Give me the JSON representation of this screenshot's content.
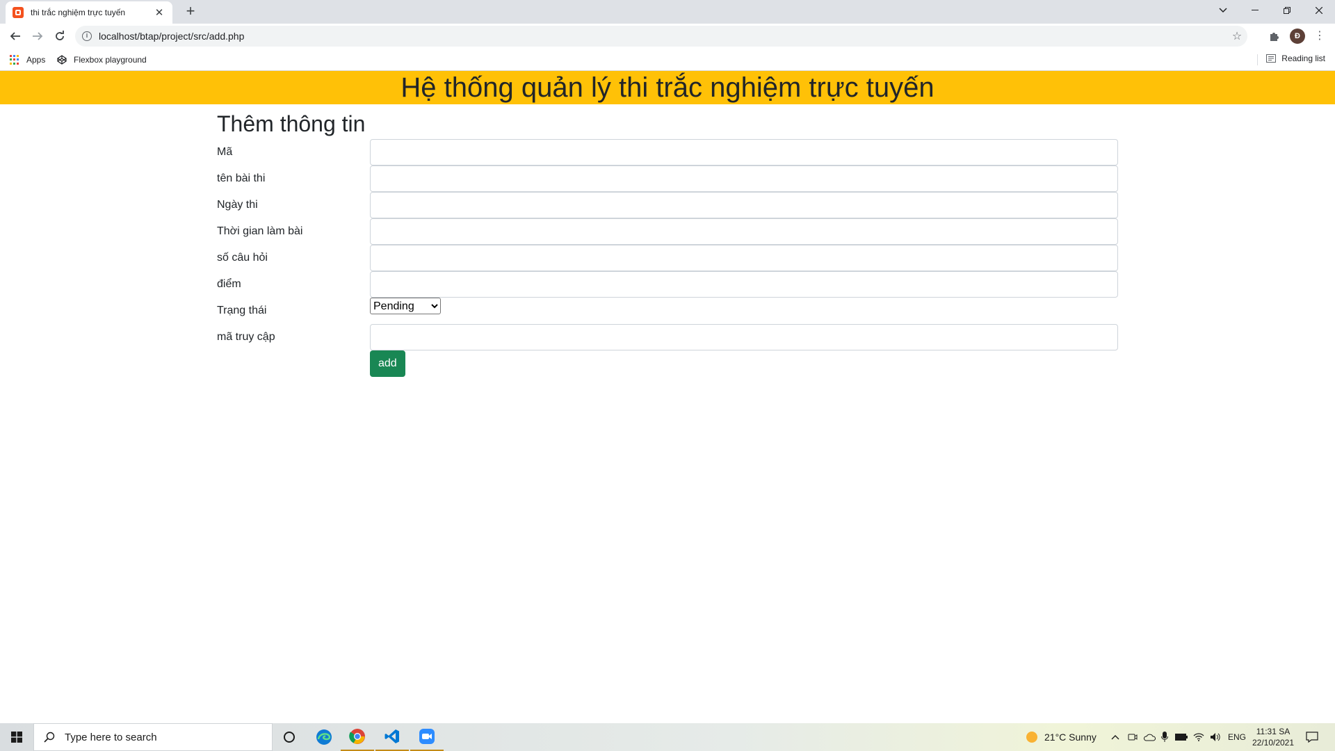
{
  "browser": {
    "tab_title": "thi trắc nghiệm trực tuyến",
    "tab_close": "✕",
    "new_tab": "+",
    "url": "localhost/btap/project/src/add.php",
    "profile_initial": "Đ",
    "bookmarks": [
      {
        "label": "Apps",
        "icon": "apps-grid-icon"
      },
      {
        "label": "Flexbox playground",
        "icon": "codepen-icon"
      }
    ],
    "reading_list": "Reading list"
  },
  "page": {
    "banner": "Hệ thống quản lý thi trắc nghiệm trực tuyến",
    "form_title": "Thêm thông tin",
    "fields": {
      "ma": "Mã",
      "ten_bai_thi": "tên bài thi",
      "ngay_thi": "Ngày thi",
      "thoi_gian": "Thời gian làm bài",
      "so_cau_hoi": "số câu hỏi",
      "diem": "điểm",
      "trang_thai": "Trạng thái",
      "ma_truy_cap": "mã truy cập"
    },
    "status_selected": "Pending",
    "submit_label": "add"
  },
  "taskbar": {
    "search_placeholder": "Type here to search",
    "weather": "21°C  Sunny",
    "lang": "ENG",
    "time": "11:31 SA",
    "date": "22/10/2021"
  },
  "colors": {
    "banner": "#ffc107",
    "submit": "#198754"
  }
}
